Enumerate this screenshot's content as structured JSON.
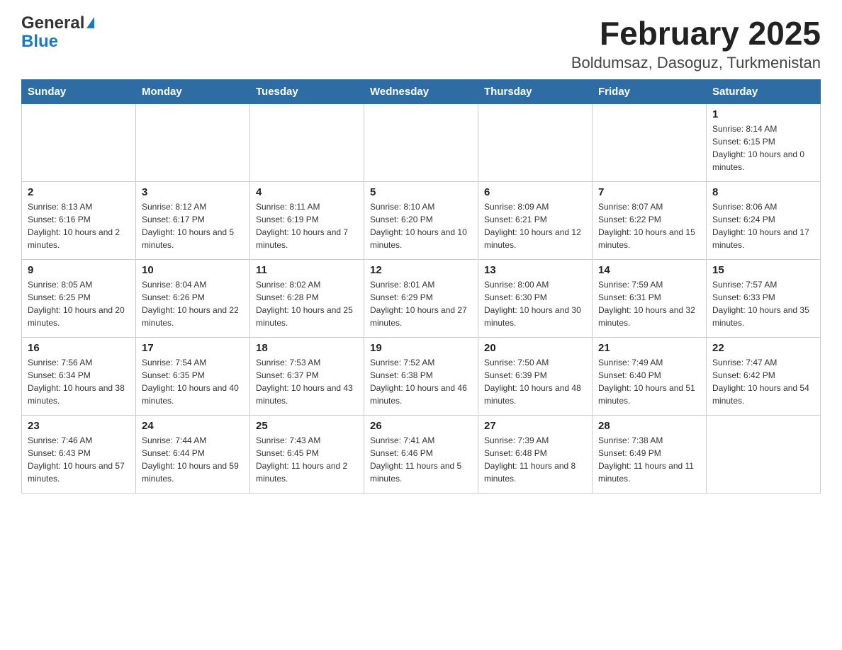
{
  "header": {
    "logo_general": "General",
    "logo_blue": "Blue",
    "title": "February 2025",
    "subtitle": "Boldumsaz, Dasoguz, Turkmenistan"
  },
  "weekdays": [
    "Sunday",
    "Monday",
    "Tuesday",
    "Wednesday",
    "Thursday",
    "Friday",
    "Saturday"
  ],
  "weeks": [
    [
      {
        "num": "",
        "sunrise": "",
        "sunset": "",
        "daylight": ""
      },
      {
        "num": "",
        "sunrise": "",
        "sunset": "",
        "daylight": ""
      },
      {
        "num": "",
        "sunrise": "",
        "sunset": "",
        "daylight": ""
      },
      {
        "num": "",
        "sunrise": "",
        "sunset": "",
        "daylight": ""
      },
      {
        "num": "",
        "sunrise": "",
        "sunset": "",
        "daylight": ""
      },
      {
        "num": "",
        "sunrise": "",
        "sunset": "",
        "daylight": ""
      },
      {
        "num": "1",
        "sunrise": "Sunrise: 8:14 AM",
        "sunset": "Sunset: 6:15 PM",
        "daylight": "Daylight: 10 hours and 0 minutes."
      }
    ],
    [
      {
        "num": "2",
        "sunrise": "Sunrise: 8:13 AM",
        "sunset": "Sunset: 6:16 PM",
        "daylight": "Daylight: 10 hours and 2 minutes."
      },
      {
        "num": "3",
        "sunrise": "Sunrise: 8:12 AM",
        "sunset": "Sunset: 6:17 PM",
        "daylight": "Daylight: 10 hours and 5 minutes."
      },
      {
        "num": "4",
        "sunrise": "Sunrise: 8:11 AM",
        "sunset": "Sunset: 6:19 PM",
        "daylight": "Daylight: 10 hours and 7 minutes."
      },
      {
        "num": "5",
        "sunrise": "Sunrise: 8:10 AM",
        "sunset": "Sunset: 6:20 PM",
        "daylight": "Daylight: 10 hours and 10 minutes."
      },
      {
        "num": "6",
        "sunrise": "Sunrise: 8:09 AM",
        "sunset": "Sunset: 6:21 PM",
        "daylight": "Daylight: 10 hours and 12 minutes."
      },
      {
        "num": "7",
        "sunrise": "Sunrise: 8:07 AM",
        "sunset": "Sunset: 6:22 PM",
        "daylight": "Daylight: 10 hours and 15 minutes."
      },
      {
        "num": "8",
        "sunrise": "Sunrise: 8:06 AM",
        "sunset": "Sunset: 6:24 PM",
        "daylight": "Daylight: 10 hours and 17 minutes."
      }
    ],
    [
      {
        "num": "9",
        "sunrise": "Sunrise: 8:05 AM",
        "sunset": "Sunset: 6:25 PM",
        "daylight": "Daylight: 10 hours and 20 minutes."
      },
      {
        "num": "10",
        "sunrise": "Sunrise: 8:04 AM",
        "sunset": "Sunset: 6:26 PM",
        "daylight": "Daylight: 10 hours and 22 minutes."
      },
      {
        "num": "11",
        "sunrise": "Sunrise: 8:02 AM",
        "sunset": "Sunset: 6:28 PM",
        "daylight": "Daylight: 10 hours and 25 minutes."
      },
      {
        "num": "12",
        "sunrise": "Sunrise: 8:01 AM",
        "sunset": "Sunset: 6:29 PM",
        "daylight": "Daylight: 10 hours and 27 minutes."
      },
      {
        "num": "13",
        "sunrise": "Sunrise: 8:00 AM",
        "sunset": "Sunset: 6:30 PM",
        "daylight": "Daylight: 10 hours and 30 minutes."
      },
      {
        "num": "14",
        "sunrise": "Sunrise: 7:59 AM",
        "sunset": "Sunset: 6:31 PM",
        "daylight": "Daylight: 10 hours and 32 minutes."
      },
      {
        "num": "15",
        "sunrise": "Sunrise: 7:57 AM",
        "sunset": "Sunset: 6:33 PM",
        "daylight": "Daylight: 10 hours and 35 minutes."
      }
    ],
    [
      {
        "num": "16",
        "sunrise": "Sunrise: 7:56 AM",
        "sunset": "Sunset: 6:34 PM",
        "daylight": "Daylight: 10 hours and 38 minutes."
      },
      {
        "num": "17",
        "sunrise": "Sunrise: 7:54 AM",
        "sunset": "Sunset: 6:35 PM",
        "daylight": "Daylight: 10 hours and 40 minutes."
      },
      {
        "num": "18",
        "sunrise": "Sunrise: 7:53 AM",
        "sunset": "Sunset: 6:37 PM",
        "daylight": "Daylight: 10 hours and 43 minutes."
      },
      {
        "num": "19",
        "sunrise": "Sunrise: 7:52 AM",
        "sunset": "Sunset: 6:38 PM",
        "daylight": "Daylight: 10 hours and 46 minutes."
      },
      {
        "num": "20",
        "sunrise": "Sunrise: 7:50 AM",
        "sunset": "Sunset: 6:39 PM",
        "daylight": "Daylight: 10 hours and 48 minutes."
      },
      {
        "num": "21",
        "sunrise": "Sunrise: 7:49 AM",
        "sunset": "Sunset: 6:40 PM",
        "daylight": "Daylight: 10 hours and 51 minutes."
      },
      {
        "num": "22",
        "sunrise": "Sunrise: 7:47 AM",
        "sunset": "Sunset: 6:42 PM",
        "daylight": "Daylight: 10 hours and 54 minutes."
      }
    ],
    [
      {
        "num": "23",
        "sunrise": "Sunrise: 7:46 AM",
        "sunset": "Sunset: 6:43 PM",
        "daylight": "Daylight: 10 hours and 57 minutes."
      },
      {
        "num": "24",
        "sunrise": "Sunrise: 7:44 AM",
        "sunset": "Sunset: 6:44 PM",
        "daylight": "Daylight: 10 hours and 59 minutes."
      },
      {
        "num": "25",
        "sunrise": "Sunrise: 7:43 AM",
        "sunset": "Sunset: 6:45 PM",
        "daylight": "Daylight: 11 hours and 2 minutes."
      },
      {
        "num": "26",
        "sunrise": "Sunrise: 7:41 AM",
        "sunset": "Sunset: 6:46 PM",
        "daylight": "Daylight: 11 hours and 5 minutes."
      },
      {
        "num": "27",
        "sunrise": "Sunrise: 7:39 AM",
        "sunset": "Sunset: 6:48 PM",
        "daylight": "Daylight: 11 hours and 8 minutes."
      },
      {
        "num": "28",
        "sunrise": "Sunrise: 7:38 AM",
        "sunset": "Sunset: 6:49 PM",
        "daylight": "Daylight: 11 hours and 11 minutes."
      },
      {
        "num": "",
        "sunrise": "",
        "sunset": "",
        "daylight": ""
      }
    ]
  ]
}
